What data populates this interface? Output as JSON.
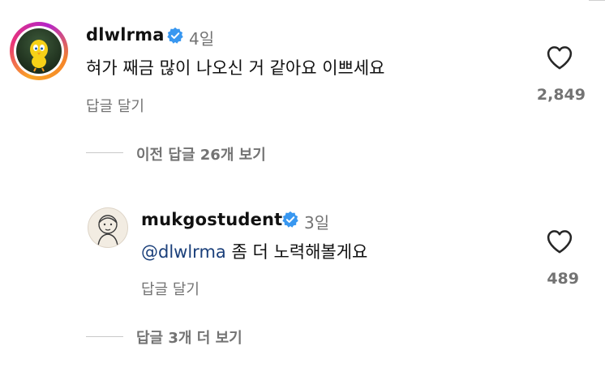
{
  "comment": {
    "username": "dlwlrma",
    "time": "4일",
    "text": "혀가 째금 많이 나오신 거 같아요 이쁘세요",
    "reply_label": "답글 달기",
    "like_count": "2,849"
  },
  "previous_replies_label": "이전 답글 26개 보기",
  "reply": {
    "username": "mukgostudent",
    "time": "3일",
    "mention": "@dlwlrma",
    "text": "좀 더 노력해볼게요",
    "reply_label": "답글 달기",
    "like_count": "489"
  },
  "more_replies_label": "답글 3개 더 보기",
  "icons": {
    "verified": "verified-badge-icon",
    "like": "heart-icon"
  },
  "colors": {
    "verified": "#3897f0",
    "muted": "#737373",
    "mention": "#1a3f7a"
  }
}
